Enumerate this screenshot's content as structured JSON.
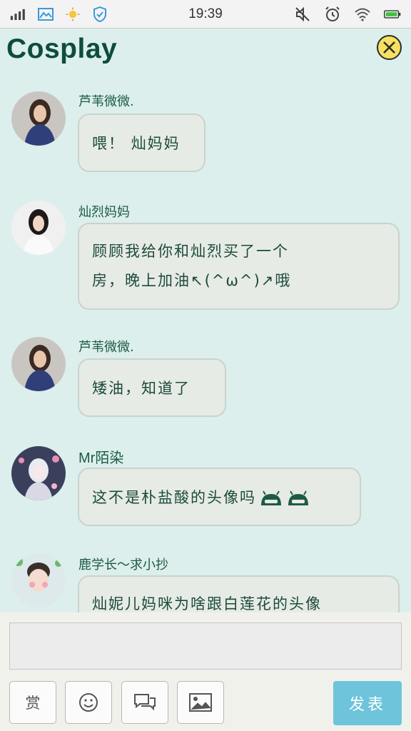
{
  "status_bar": {
    "time": "19:39"
  },
  "header": {
    "title": "Cosplay"
  },
  "messages": [
    {
      "sender": "芦苇微微.",
      "lines": [
        "喂！ 灿妈妈"
      ]
    },
    {
      "sender": "灿烈妈妈",
      "lines": [
        "顾顾我给你和灿烈买了一个",
        "房，晚上加油↖(^ω^)↗哦"
      ]
    },
    {
      "sender": "芦苇微微.",
      "lines": [
        "矮油，知道了"
      ]
    },
    {
      "sender": "Mr陌染",
      "lines": [
        "这不是朴盐酸的头像吗"
      ]
    },
    {
      "sender": "鹿学长～求小抄",
      "lines": [
        "灿妮儿妈咪为啥跟白莲花的头像"
      ]
    }
  ],
  "composer": {
    "reward_label": "赏",
    "send_label": "发表"
  },
  "colors": {
    "background": "#dcefec",
    "accent": "#0e4c3c",
    "send": "#6ec4da"
  }
}
